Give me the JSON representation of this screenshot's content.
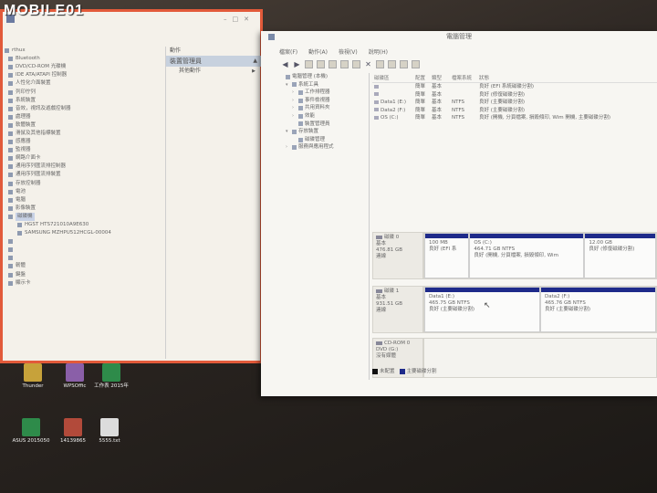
{
  "watermark": "MOBILE01",
  "device_manager": {
    "tree_items": [
      {
        "label": "rthux",
        "level": 0
      },
      {
        "label": "Bluetooth",
        "level": 1
      },
      {
        "label": "DVD/CD-ROM 光碟機",
        "level": 1
      },
      {
        "label": "IDE ATA/ATAPI 控制器",
        "level": 1
      },
      {
        "label": "人性化介面裝置",
        "level": 1
      },
      {
        "label": "列印佇列",
        "level": 1
      },
      {
        "label": "系統裝置",
        "level": 1
      },
      {
        "label": "音效，視訊及遊戲控制器",
        "level": 1
      },
      {
        "label": "處理器",
        "level": 1
      },
      {
        "label": "軟體裝置",
        "level": 1
      },
      {
        "label": "滑鼠及其他指標裝置",
        "level": 1
      },
      {
        "label": "感應器",
        "level": 1
      },
      {
        "label": "監視器",
        "level": 1
      },
      {
        "label": "網路介面卡",
        "level": 1
      },
      {
        "label": "通用序列匯流排控制器",
        "level": 1
      },
      {
        "label": "通用序列匯流排裝置",
        "level": 1
      },
      {
        "label": "存放控制器",
        "level": 1
      },
      {
        "label": "電池",
        "level": 1
      },
      {
        "label": "電腦",
        "level": 1
      },
      {
        "label": "影像裝置",
        "level": 1
      },
      {
        "label": "磁碟機",
        "level": 1,
        "selected": true
      },
      {
        "label": "HGST HTS721010A9E630",
        "level": 2
      },
      {
        "label": "SAMSUNG MZHPU512HCGL-00004",
        "level": 2
      },
      {
        "label": "",
        "level": 1
      },
      {
        "label": "",
        "level": 1
      },
      {
        "label": "",
        "level": 1
      },
      {
        "label": "韌體",
        "level": 1
      },
      {
        "label": "鍵盤",
        "level": 1
      },
      {
        "label": "顯示卡",
        "level": 1
      }
    ],
    "actions": {
      "title": "動作",
      "section": "裝置管理員",
      "item": "其他動作"
    }
  },
  "desktop_icons": [
    {
      "label": "Thunder",
      "color": "#c7a23a"
    },
    {
      "label": "WPSOffic",
      "color": "#8a5fa8"
    },
    {
      "label": "工作表 2015年",
      "color": "#2e8b4a"
    },
    {
      "label": "ASUS 2015050",
      "color": "#2e8b4a"
    },
    {
      "label": "14139865",
      "color": "#b24a3a"
    },
    {
      "label": "5555.txt",
      "color": "#dcdcdc"
    }
  ],
  "computer_management": {
    "title": "電腦管理",
    "menu": [
      "檔案(F)",
      "動作(A)",
      "檢視(V)",
      "說明(H)"
    ],
    "tree": [
      {
        "label": "電腦管理 (本機)",
        "exp": "",
        "indent": 0
      },
      {
        "label": "系統工具",
        "exp": "▾",
        "indent": 1
      },
      {
        "label": "工作排程器",
        "exp": "›",
        "indent": 2
      },
      {
        "label": "事件檢視器",
        "exp": "›",
        "indent": 2
      },
      {
        "label": "共用資料夾",
        "exp": "›",
        "indent": 2
      },
      {
        "label": "效能",
        "exp": "›",
        "indent": 2
      },
      {
        "label": "裝置管理員",
        "exp": "",
        "indent": 2
      },
      {
        "label": "存放裝置",
        "exp": "▾",
        "indent": 1
      },
      {
        "label": "磁碟管理",
        "exp": "",
        "indent": 2
      },
      {
        "label": "服務與應用程式",
        "exp": "›",
        "indent": 1
      }
    ],
    "volume_headers": [
      "磁碟區",
      "配置",
      "類型",
      "檔案系統",
      "狀態"
    ],
    "volumes": [
      {
        "vol": "",
        "layout": "簡單",
        "type": "基本",
        "fs": "",
        "status": "良好 (EFI 系統磁碟分割)"
      },
      {
        "vol": "",
        "layout": "簡單",
        "type": "基本",
        "fs": "",
        "status": "良好 (修復磁碟分割)"
      },
      {
        "vol": "Data1 (E:)",
        "layout": "簡單",
        "type": "基本",
        "fs": "NTFS",
        "status": "良好 (主要磁碟分割)"
      },
      {
        "vol": "Data2 (F:)",
        "layout": "簡單",
        "type": "基本",
        "fs": "NTFS",
        "status": "良好 (主要磁碟分割)"
      },
      {
        "vol": "OS (C:)",
        "layout": "簡單",
        "type": "基本",
        "fs": "NTFS",
        "status": "良好 (開機, 分頁檔案, 損毀傾印, Wim 開機, 主要磁碟分割)"
      }
    ],
    "disks": [
      {
        "name": "磁碟 0",
        "type": "基本",
        "size": "476.81 GB",
        "state": "連線",
        "parts": [
          {
            "name": "",
            "size": "100 MB",
            "status": "良好 (EFI 系",
            "flex": 1.05,
            "unalloc": false
          },
          {
            "name": "OS (C:)",
            "size": "464.71 GB NTFS",
            "status": "良好 (開機, 分頁檔案, 損毀傾印, Wim",
            "flex": 2.75,
            "unalloc": false
          },
          {
            "name": "",
            "size": "12.00 GB",
            "status": "良好 (修復磁碟分割)",
            "flex": 1.7,
            "unalloc": false
          }
        ]
      },
      {
        "name": "磁碟 1",
        "type": "基本",
        "size": "931.51 GB",
        "state": "連線",
        "parts": [
          {
            "name": "Data1 (E:)",
            "size": "465.75 GB NTFS",
            "status": "良好 (主要磁碟分割)",
            "flex": 1,
            "unalloc": false
          },
          {
            "name": "Data2 (F:)",
            "size": "465.76 GB NTFS",
            "status": "良好 (主要磁碟分割)",
            "flex": 1,
            "unalloc": false
          }
        ]
      },
      {
        "name": "CD-ROM 0",
        "type": "DVD (G:)",
        "size": "",
        "state": "沒有媒體",
        "parts": []
      }
    ],
    "legend": [
      {
        "label": "未配置",
        "color": "#111111"
      },
      {
        "label": "主要磁碟分割",
        "color": "#1e2a8a"
      }
    ]
  }
}
